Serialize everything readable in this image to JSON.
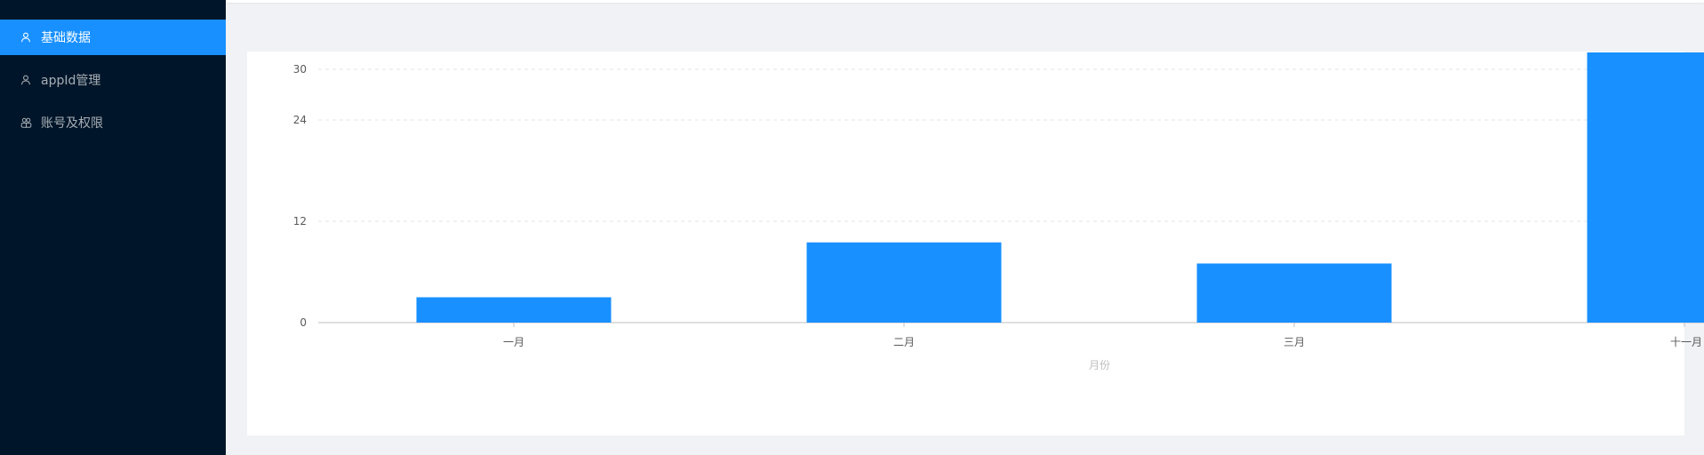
{
  "sidebar": {
    "items": [
      {
        "label": "基础数据",
        "icon": "user-icon",
        "active": true
      },
      {
        "label": "appId管理",
        "icon": "user-icon",
        "active": false
      },
      {
        "label": "账号及权限",
        "icon": "team-icon",
        "active": false
      }
    ]
  },
  "colors": {
    "sidebar_bg": "#001529",
    "accent": "#1890ff",
    "page_bg": "#f0f2f5"
  },
  "chart_data": {
    "type": "bar",
    "categories": [
      "一月",
      "二月",
      "三月",
      "十一月"
    ],
    "values": [
      3,
      9.5,
      7,
      32
    ],
    "title": "",
    "xlabel": "月份",
    "ylabel": "",
    "yticks": [
      0,
      12,
      24,
      30
    ],
    "ylim": [
      0,
      30
    ],
    "grid": true,
    "bar_color": "#1890ff"
  }
}
